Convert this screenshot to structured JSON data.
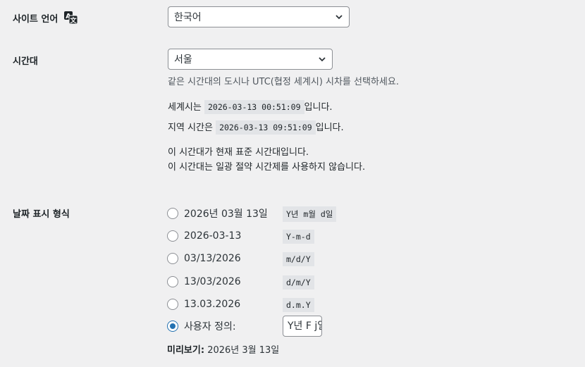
{
  "site_language": {
    "label": "사이트 언어",
    "icon": "translate-icon",
    "selected": "한국어"
  },
  "timezone": {
    "label": "시간대",
    "selected": "서울",
    "description": "같은 시간대의 도시나 UTC(협정 세계시) 시차를 선택하세요.",
    "utc_prefix": "세계시는",
    "utc_time": "2026-03-13 00:51:09",
    "utc_suffix": "입니다.",
    "local_prefix": "지역 시간은",
    "local_time": "2026-03-13 09:51:09",
    "local_suffix": "입니다.",
    "standard_note": "이 시간대가 현재 표준 시간대입니다.",
    "dst_note": "이 시간대는 일광 절약 시간제를 사용하지 않습니다."
  },
  "date_format": {
    "label": "날짜 표시 형식",
    "options": [
      {
        "label": "2026년 03월 13일",
        "format": "Y년 m월 d일",
        "checked": false
      },
      {
        "label": "2026-03-13",
        "format": "Y-m-d",
        "checked": false
      },
      {
        "label": "03/13/2026",
        "format": "m/d/Y",
        "checked": false
      },
      {
        "label": "13/03/2026",
        "format": "d/m/Y",
        "checked": false
      },
      {
        "label": "13.03.2026",
        "format": "d.m.Y",
        "checked": false
      },
      {
        "label": "사용자 정의:",
        "format": "",
        "checked": true
      }
    ],
    "custom_value": "Y년 F j일",
    "preview_label": "미리보기:",
    "preview_value": "2026년 3월 13일"
  }
}
